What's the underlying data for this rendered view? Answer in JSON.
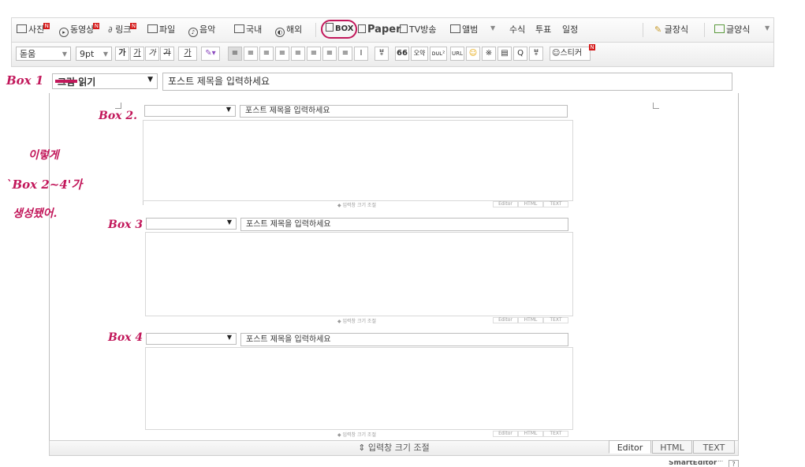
{
  "toolbar1": {
    "items": [
      {
        "label": "사진",
        "new": true
      },
      {
        "label": "동영상",
        "new": true
      },
      {
        "label": "링크",
        "new": true
      },
      {
        "label": "파일"
      },
      {
        "label": "음악"
      },
      {
        "label": "국내"
      },
      {
        "label": "해외"
      },
      {
        "label": "BOX"
      },
      {
        "label": "Paper"
      },
      {
        "label": "TV방송"
      },
      {
        "label": "앨범"
      }
    ],
    "more_items": [
      "수식",
      "투표",
      "일정"
    ],
    "right_items": [
      "글장식",
      "글양식"
    ],
    "new_badge": "N"
  },
  "toolbar2": {
    "font": "돋움",
    "size": "9pt",
    "format_buttons": [
      "가",
      "가",
      "가",
      "가",
      "가"
    ],
    "list_buttons": [
      "≡",
      "≡",
      "≡",
      "≡",
      "≡",
      "≡",
      "≡",
      "≡",
      "I"
    ],
    "insert_buttons": [
      "66",
      "오약",
      "ᴅᴜʟ²",
      "URL",
      "☺",
      "※",
      "▤",
      "Q",
      "ㅸ"
    ],
    "sticker": "스티커"
  },
  "main": {
    "category": "그림 읽기",
    "title_placeholder": "포스트 제목을 입력하세요"
  },
  "nested_boxes": [
    {
      "placeholder": "포스트 제목을 입력하세요",
      "footer": "◆ 입력창 크기 조절",
      "modes": [
        "Editor",
        "HTML",
        "TEXT"
      ]
    },
    {
      "placeholder": "포스트 제목을 입력하세요",
      "footer": "◆ 입력창 크기 조절",
      "modes": [
        "Editor",
        "HTML",
        "TEXT"
      ]
    },
    {
      "placeholder": "포스트 제목을 입력하세요",
      "footer": "◆ 입력창 크기 조절",
      "modes": [
        "Editor",
        "HTML",
        "TEXT"
      ]
    }
  ],
  "bottom": {
    "resize_label": "⇕ 입력창 크기 조절",
    "modes": [
      "Editor",
      "HTML",
      "TEXT"
    ],
    "brand": "SmartEditor™",
    "help": "?"
  },
  "annotations": {
    "box1": "Box 1",
    "box2": "Box 2.",
    "box3": "Box 3",
    "box4": "Box 4",
    "note_line1": "이렇게",
    "note_line2": "`Box 2~4'가",
    "note_line3": "생성됐어."
  },
  "colors": {
    "annotation": "#c2185b",
    "new_badge": "#d51a1a"
  }
}
